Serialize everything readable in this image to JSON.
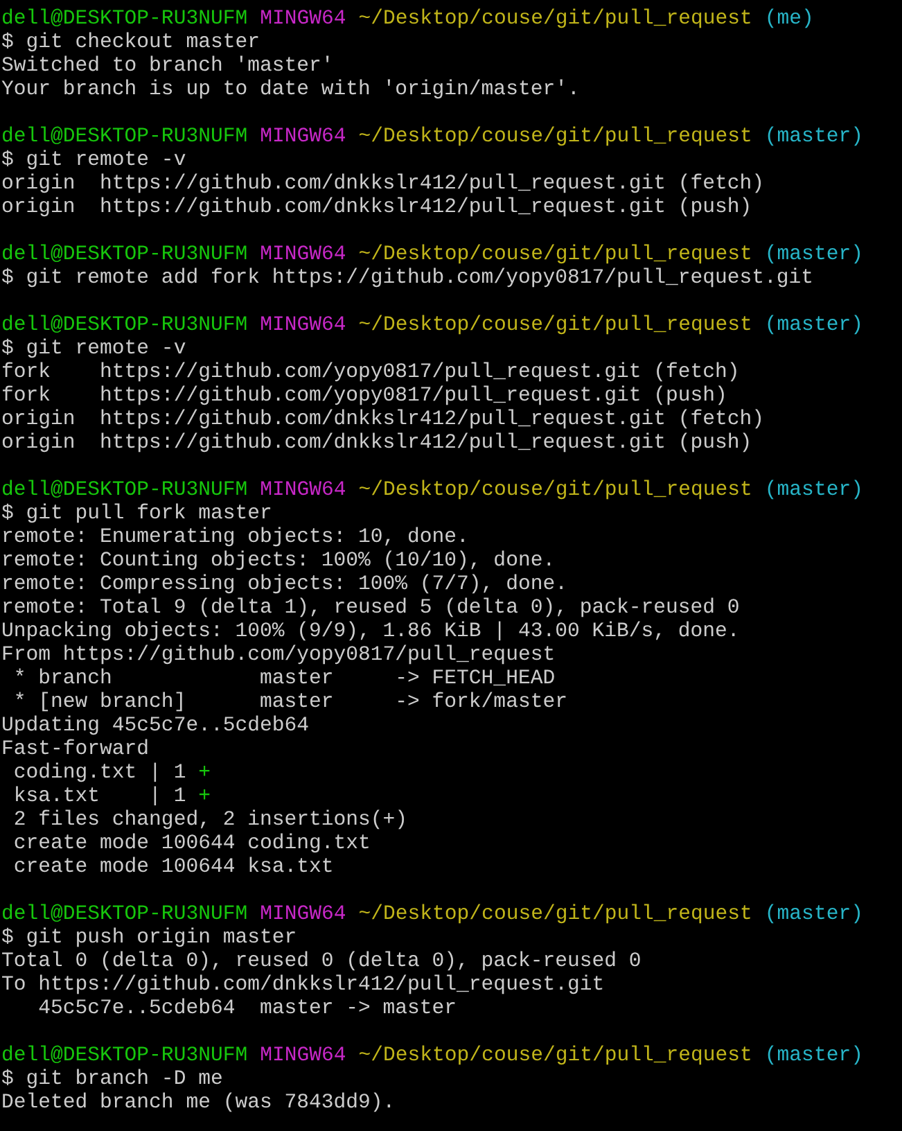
{
  "terminal": {
    "blocks": [
      {
        "prompt": {
          "user_host": "dell@DESKTOP-RU3NUFM",
          "system": "MINGW64",
          "path": "~/Desktop/couse/git/pull_request",
          "branch": "(me)"
        },
        "command": "$ git checkout master",
        "output": [
          {
            "kind": "plain",
            "text": "Switched to branch 'master'"
          },
          {
            "kind": "plain",
            "text": "Your branch is up to date with 'origin/master'."
          }
        ]
      },
      {
        "prompt": {
          "user_host": "dell@DESKTOP-RU3NUFM",
          "system": "MINGW64",
          "path": "~/Desktop/couse/git/pull_request",
          "branch": "(master)"
        },
        "command": "$ git remote -v",
        "output": [
          {
            "kind": "plain",
            "text": "origin  https://github.com/dnkkslr412/pull_request.git (fetch)"
          },
          {
            "kind": "plain",
            "text": "origin  https://github.com/dnkkslr412/pull_request.git (push)"
          }
        ]
      },
      {
        "prompt": {
          "user_host": "dell@DESKTOP-RU3NUFM",
          "system": "MINGW64",
          "path": "~/Desktop/couse/git/pull_request",
          "branch": "(master)"
        },
        "command": "$ git remote add fork https://github.com/yopy0817/pull_request.git"
      },
      {
        "prompt": {
          "user_host": "dell@DESKTOP-RU3NUFM",
          "system": "MINGW64",
          "path": "~/Desktop/couse/git/pull_request",
          "branch": "(master)"
        },
        "command": "$ git remote -v",
        "output": [
          {
            "kind": "plain",
            "text": "fork    https://github.com/yopy0817/pull_request.git (fetch)"
          },
          {
            "kind": "plain",
            "text": "fork    https://github.com/yopy0817/pull_request.git (push)"
          },
          {
            "kind": "plain",
            "text": "origin  https://github.com/dnkkslr412/pull_request.git (fetch)"
          },
          {
            "kind": "plain",
            "text": "origin  https://github.com/dnkkslr412/pull_request.git (push)"
          }
        ]
      },
      {
        "prompt": {
          "user_host": "dell@DESKTOP-RU3NUFM",
          "system": "MINGW64",
          "path": "~/Desktop/couse/git/pull_request",
          "branch": "(master)"
        },
        "command": "$ git pull fork master",
        "output": [
          {
            "kind": "plain",
            "text": "remote: Enumerating objects: 10, done."
          },
          {
            "kind": "plain",
            "text": "remote: Counting objects: 100% (10/10), done."
          },
          {
            "kind": "plain",
            "text": "remote: Compressing objects: 100% (7/7), done."
          },
          {
            "kind": "plain",
            "text": "remote: Total 9 (delta 1), reused 5 (delta 0), pack-reused 0"
          },
          {
            "kind": "plain",
            "text": "Unpacking objects: 100% (9/9), 1.86 KiB | 43.00 KiB/s, done."
          },
          {
            "kind": "plain",
            "text": "From https://github.com/yopy0817/pull_request"
          },
          {
            "kind": "plain",
            "text": " * branch            master     -> FETCH_HEAD"
          },
          {
            "kind": "plain",
            "text": " * [new branch]      master     -> fork/master"
          },
          {
            "kind": "plain",
            "text": "Updating 45c5c7e..5cdeb64"
          },
          {
            "kind": "plain",
            "text": "Fast-forward"
          },
          {
            "kind": "diffstat",
            "text": " coding.txt | 1 ",
            "graph": "+"
          },
          {
            "kind": "diffstat",
            "text": " ksa.txt    | 1 ",
            "graph": "+"
          },
          {
            "kind": "plain",
            "text": " 2 files changed, 2 insertions(+)"
          },
          {
            "kind": "plain",
            "text": " create mode 100644 coding.txt"
          },
          {
            "kind": "plain",
            "text": " create mode 100644 ksa.txt"
          }
        ]
      },
      {
        "prompt": {
          "user_host": "dell@DESKTOP-RU3NUFM",
          "system": "MINGW64",
          "path": "~/Desktop/couse/git/pull_request",
          "branch": "(master)"
        },
        "command": "$ git push origin master",
        "output": [
          {
            "kind": "plain",
            "text": "Total 0 (delta 0), reused 0 (delta 0), pack-reused 0"
          },
          {
            "kind": "plain",
            "text": "To https://github.com/dnkkslr412/pull_request.git"
          },
          {
            "kind": "plain",
            "text": "   45c5c7e..5cdeb64  master -> master"
          }
        ]
      },
      {
        "prompt": {
          "user_host": "dell@DESKTOP-RU3NUFM",
          "system": "MINGW64",
          "path": "~/Desktop/couse/git/pull_request",
          "branch": "(master)"
        },
        "command": "$ git branch -D me",
        "output": [
          {
            "kind": "plain",
            "text": "Deleted branch me (was 7843dd9)."
          }
        ]
      }
    ]
  }
}
